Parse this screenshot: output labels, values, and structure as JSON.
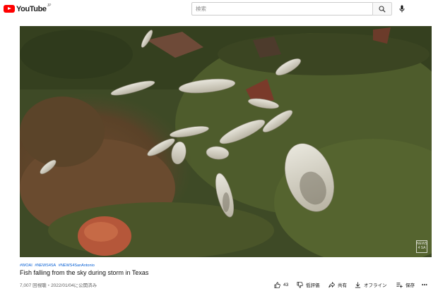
{
  "header": {
    "logo_text": "YouTube",
    "logo_country": "JP",
    "search_placeholder": "検索"
  },
  "player": {
    "watermark": "NEWS 4 SA"
  },
  "video": {
    "hashtags": [
      "#WOAI",
      "#NEWS4SA",
      "#NEWS4SanAntonio"
    ],
    "title": "Fish falling from the sky during storm in Texas",
    "meta": "7,007 回視聴・2022/01/04に公開済み"
  },
  "actions": {
    "like_count": "43",
    "dislike_label": "低評価",
    "share_label": "共有",
    "offline_label": "オフライン",
    "save_label": "保存",
    "more_label": "•••"
  },
  "colors": {
    "brand": "#ff0000",
    "link": "#065fd4"
  }
}
